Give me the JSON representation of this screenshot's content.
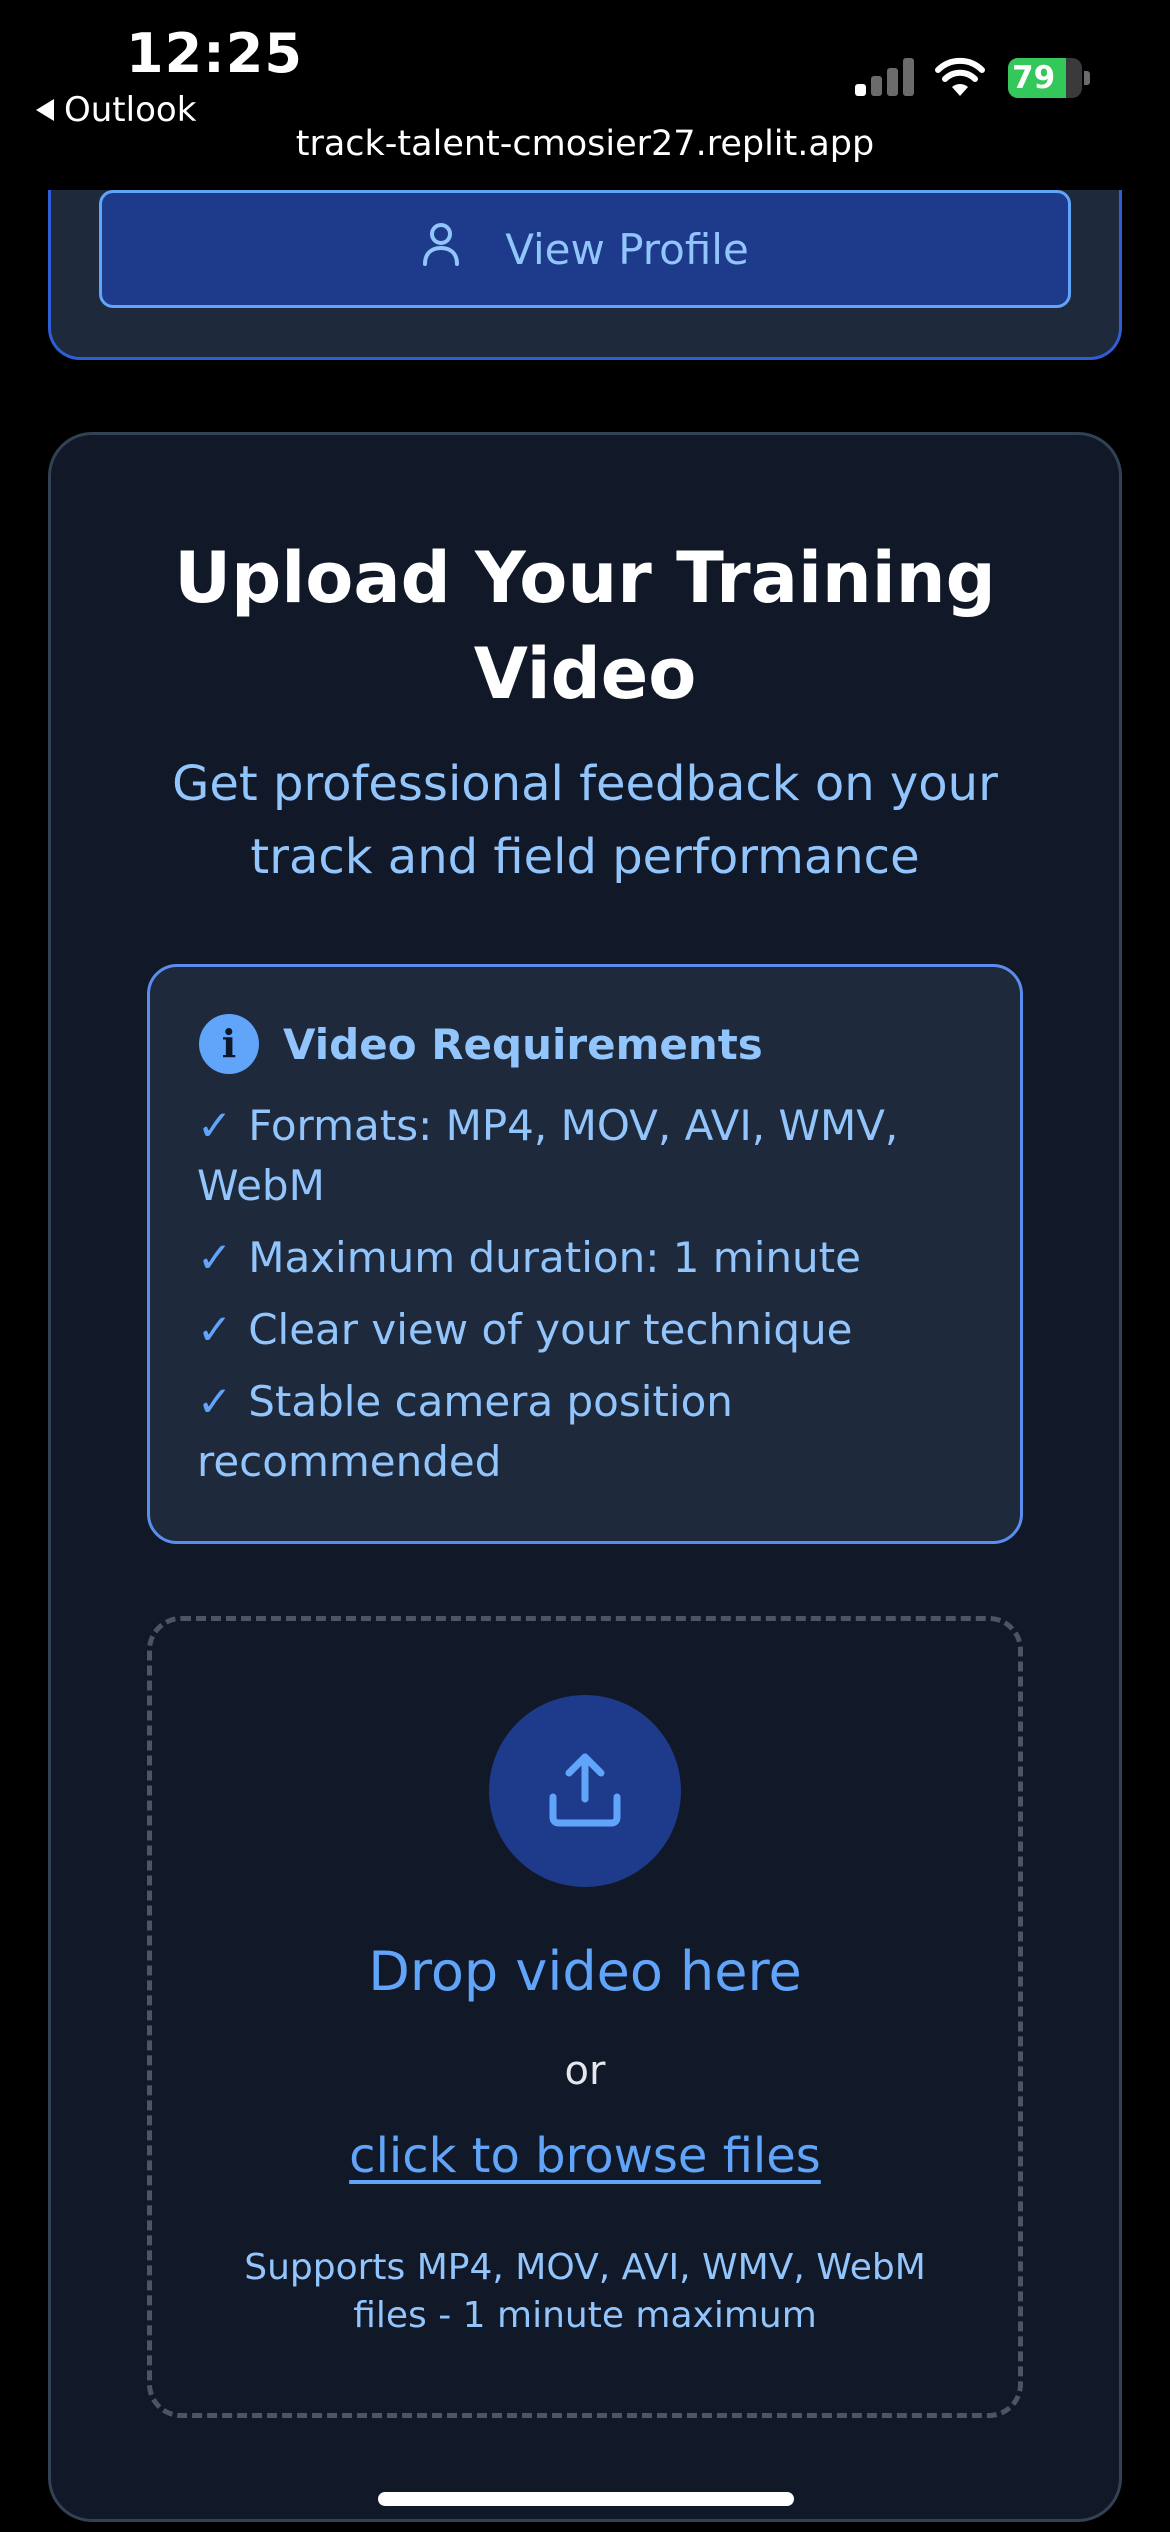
{
  "status_bar": {
    "time": "12:25",
    "back_app": "Outlook",
    "url": "track-talent-cmosier27.replit.app",
    "battery_percent": "79",
    "battery_level": 0.79,
    "signal_bars_active": 1
  },
  "profile_card": {
    "view_profile_label": "View Profile",
    "icon": "user-icon"
  },
  "upload": {
    "title_line1": "Upload Your Training",
    "title_line2": "Video",
    "subtitle": "Get professional feedback on your track and field performance",
    "requirements": {
      "icon": "info-icon",
      "info_glyph": "i",
      "title": "Video Requirements",
      "check_glyph": "✓",
      "items": [
        "Formats: MP4, MOV, AVI, WMV, WebM",
        "Maximum duration: 1 minute",
        "Clear view of your technique",
        "Stable camera position recommended"
      ]
    },
    "drop_zone": {
      "icon": "upload-icon",
      "drop_text": "Drop video here",
      "or_text": "or",
      "browse_link": "click to browse files",
      "support_text": "Supports MP4, MOV, AVI, WMV, WebM files - 1 minute maximum"
    }
  },
  "colors": {
    "accent": "#60a5fa",
    "accent_light": "#93c5fd",
    "card_bg": "#111827",
    "button_bg": "#1e3a8a",
    "battery": "#34c759"
  }
}
